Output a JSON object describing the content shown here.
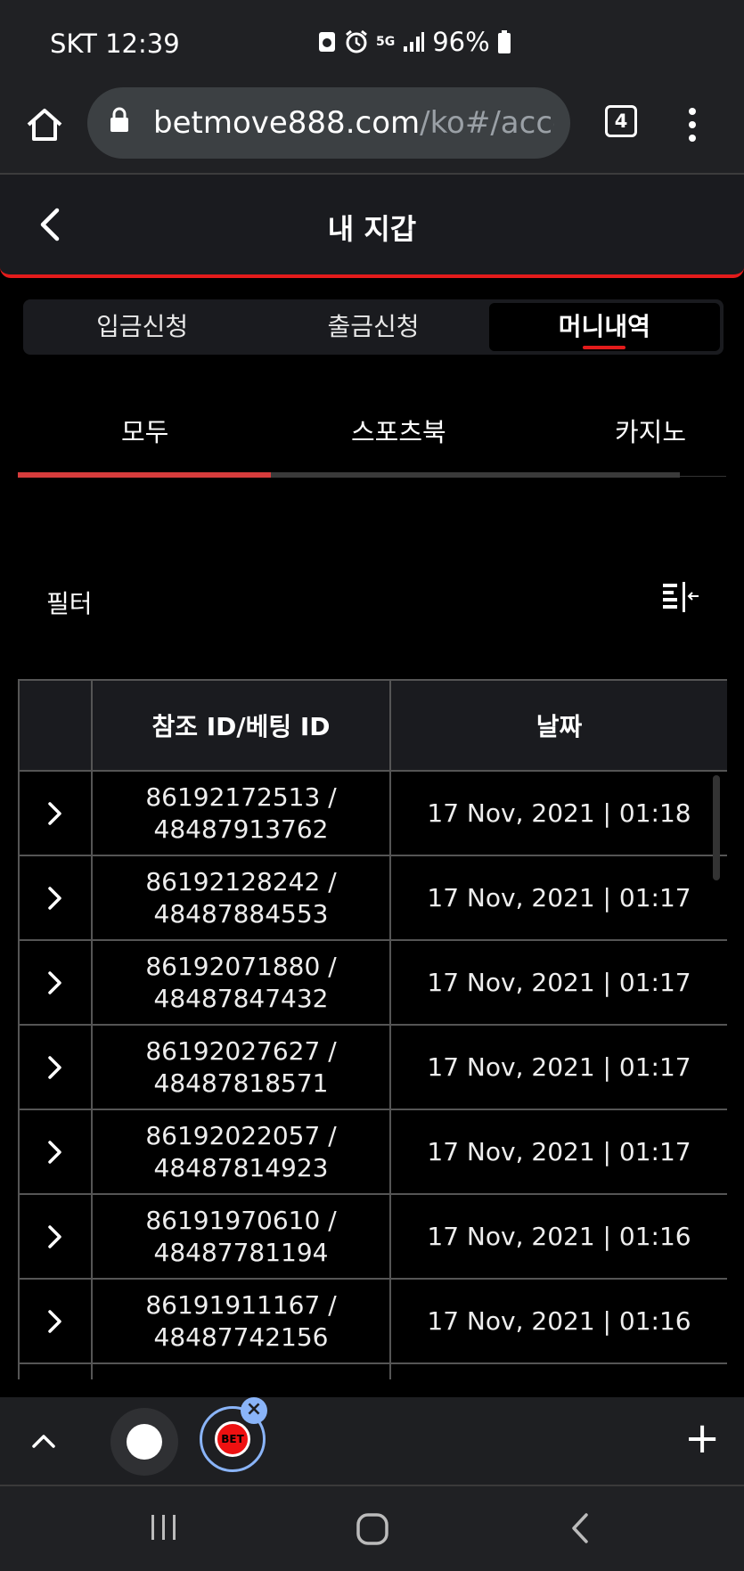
{
  "status_bar": {
    "carrier_time": "SKT 12:39",
    "battery": "96%",
    "network": "5G"
  },
  "browser": {
    "url_main": "betmove888.com",
    "url_rest": "/ko#/accou",
    "tab_count": "4"
  },
  "header": {
    "title": "내 지갑"
  },
  "segment_tabs": [
    {
      "label": "입금신청"
    },
    {
      "label": "출금신청"
    },
    {
      "label": "머니내역"
    }
  ],
  "category_tabs": [
    {
      "label": "모두"
    },
    {
      "label": "스포츠북"
    },
    {
      "label": "카지노"
    }
  ],
  "filter": {
    "label": "필터"
  },
  "table": {
    "headers": [
      "",
      "참조 ID/베팅 ID",
      "날짜"
    ],
    "rows": [
      {
        "ref_id": "86192172513 /",
        "bet_id": "48487913762",
        "date": "17 Nov, 2021 | 01:18"
      },
      {
        "ref_id": "86192128242 /",
        "bet_id": "48487884553",
        "date": "17 Nov, 2021 | 01:17"
      },
      {
        "ref_id": "86192071880 /",
        "bet_id": "48487847432",
        "date": "17 Nov, 2021 | 01:17"
      },
      {
        "ref_id": "86192027627 /",
        "bet_id": "48487818571",
        "date": "17 Nov, 2021 | 01:17"
      },
      {
        "ref_id": "86192022057 /",
        "bet_id": "48487814923",
        "date": "17 Nov, 2021 | 01:17"
      },
      {
        "ref_id": "86191970610 /",
        "bet_id": "48487781194",
        "date": "17 Nov, 2021 | 01:16"
      },
      {
        "ref_id": "86191911167 /",
        "bet_id": "48487742156",
        "date": "17 Nov, 2021 | 01:16"
      },
      {
        "ref_id": "",
        "bet_id": "",
        "date": ""
      }
    ]
  },
  "tab_strip": {
    "bubble_label": "BET",
    "plus": "+"
  },
  "colors": {
    "accent": "#e31b1b",
    "background": "#000000",
    "panel": "#1a1b1f",
    "chrome": "#202124"
  }
}
